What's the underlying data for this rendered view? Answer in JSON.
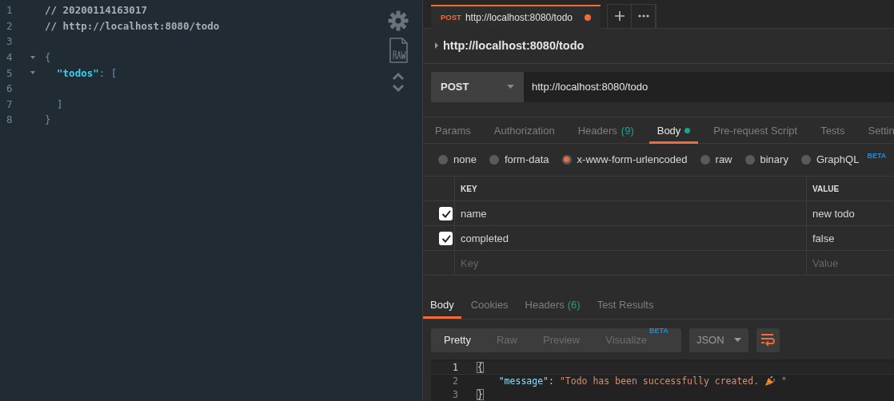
{
  "viewer": {
    "lines": [
      {
        "number": "1",
        "foldable": false,
        "tokens": [
          {
            "kind": "comment",
            "text": "// 20200114163017"
          }
        ]
      },
      {
        "number": "2",
        "foldable": false,
        "tokens": [
          {
            "kind": "comment",
            "text": "// http://localhost:8080/todo"
          }
        ]
      },
      {
        "number": "3",
        "foldable": false
      },
      {
        "number": "4",
        "foldable": true,
        "tokens": [
          {
            "kind": "punct",
            "text": "{"
          }
        ]
      },
      {
        "number": "5",
        "foldable": true,
        "tokens": [
          {
            "kind": "key",
            "text": "  \"todos\""
          },
          {
            "kind": "punct",
            "text": ": ["
          }
        ]
      },
      {
        "number": "6",
        "foldable": false
      },
      {
        "number": "7",
        "foldable": false,
        "tokens": [
          {
            "kind": "punct",
            "text": "  ]"
          }
        ]
      },
      {
        "number": "8",
        "foldable": false,
        "tokens": [
          {
            "kind": "punct",
            "text": "}"
          }
        ]
      }
    ]
  },
  "request_tab": {
    "method": "POST",
    "title": "http://localhost:8080/todo",
    "unsaved": true
  },
  "request_name": "http://localhost:8080/todo",
  "url_bar": {
    "method": "POST",
    "url": "http://localhost:8080/todo"
  },
  "request_tabs": [
    {
      "label": "Params",
      "selected": false
    },
    {
      "label": "Authorization",
      "selected": false
    },
    {
      "label": "Headers",
      "count": "(9)",
      "selected": false
    },
    {
      "label": "Body",
      "dot": true,
      "selected": true
    },
    {
      "label": "Pre-request Script",
      "selected": false
    },
    {
      "label": "Tests",
      "selected": false
    },
    {
      "label": "Settin",
      "selected": false
    }
  ],
  "body_types": [
    {
      "label": "none",
      "selected": false
    },
    {
      "label": "form-data",
      "selected": false
    },
    {
      "label": "x-www-form-urlencoded",
      "selected": true
    },
    {
      "label": "raw",
      "selected": false
    },
    {
      "label": "binary",
      "selected": false
    },
    {
      "label": "GraphQL",
      "badge": "BETA",
      "selected": false
    }
  ],
  "params_table": {
    "columns": [
      "KEY",
      "VALUE"
    ],
    "rows": [
      {
        "key": "name",
        "value": "new todo",
        "checked": true
      },
      {
        "key": "completed",
        "value": "false",
        "checked": true
      }
    ],
    "new_row": {
      "key_placeholder": "Key",
      "value_placeholder": "Value"
    }
  },
  "response_tabs": [
    {
      "label": "Body",
      "selected": true
    },
    {
      "label": "Cookies",
      "selected": false
    },
    {
      "label": "Headers",
      "count": "(6)",
      "selected": false
    },
    {
      "label": "Test Results",
      "selected": false
    }
  ],
  "view_modes": [
    {
      "label": "Pretty",
      "selected": true
    },
    {
      "label": "Raw",
      "selected": false
    },
    {
      "label": "Preview",
      "selected": false
    },
    {
      "label": "Visualize",
      "badge": "BETA",
      "selected": false
    }
  ],
  "format_select": "JSON",
  "response_body": {
    "lines": [
      {
        "number": "1",
        "active": true,
        "tokens": [
          {
            "kind": "brace-match",
            "text": "{"
          }
        ]
      },
      {
        "number": "2",
        "active": false,
        "tokens": [
          {
            "kind": "key",
            "text": "    \"message\""
          },
          {
            "kind": "punct",
            "text": ": "
          },
          {
            "kind": "string",
            "text": "\"Todo has been successfully created. "
          },
          {
            "kind": "party-emoji"
          },
          {
            "kind": "string",
            "text": " \""
          }
        ]
      },
      {
        "number": "3",
        "active": false,
        "tokens": [
          {
            "kind": "brace-match",
            "text": "}"
          }
        ]
      }
    ]
  }
}
